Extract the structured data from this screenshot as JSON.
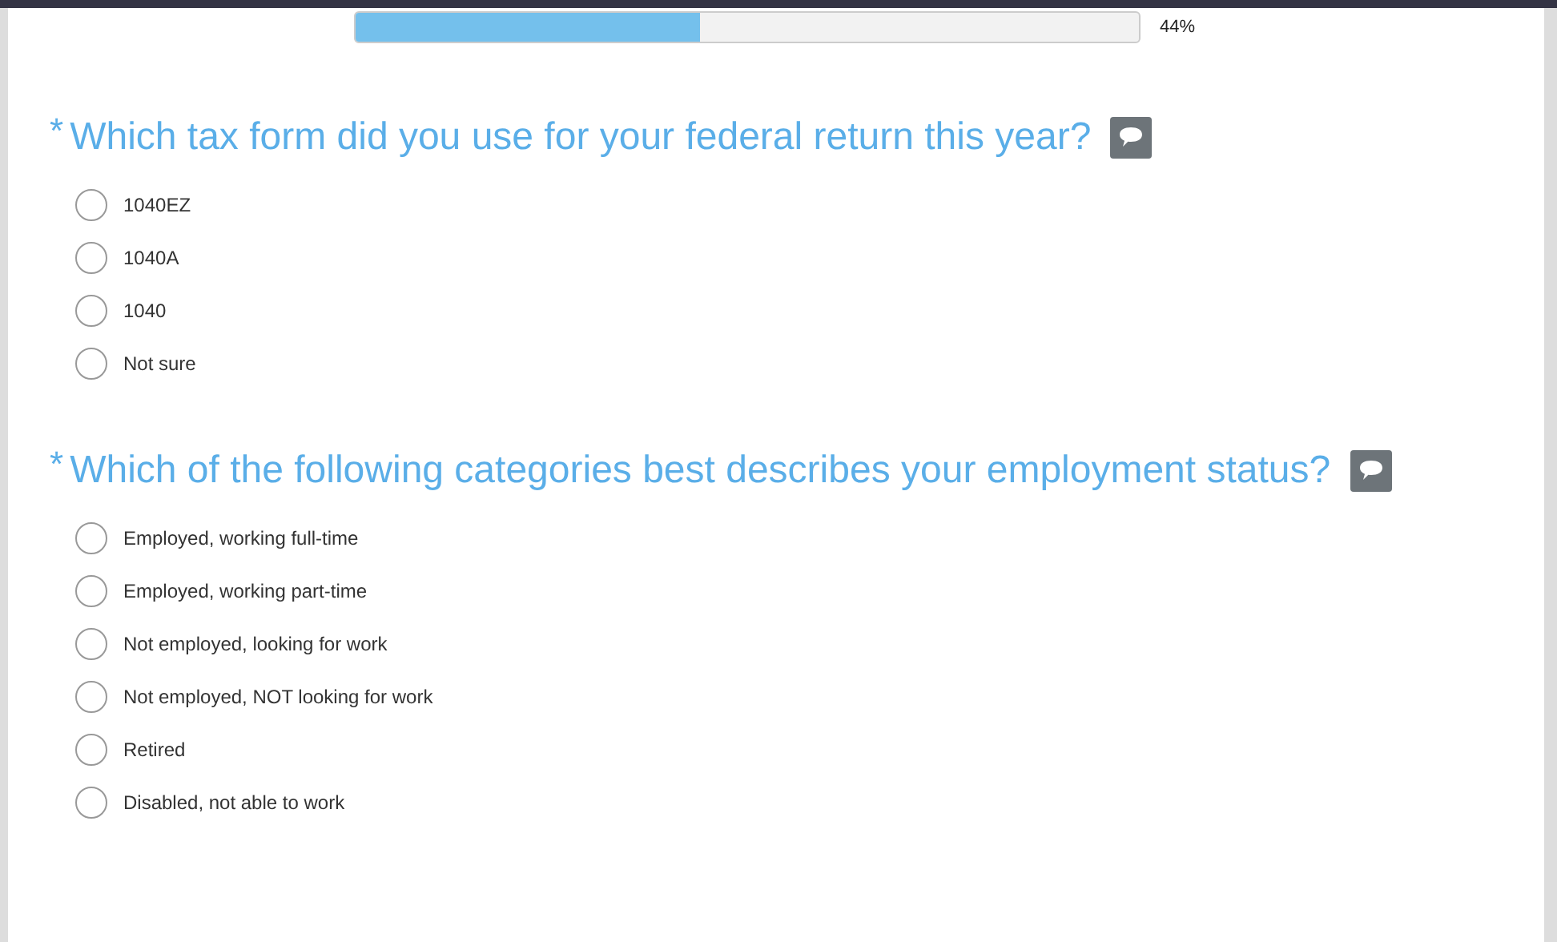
{
  "progress": {
    "level": 0.44,
    "reading": "44%"
  },
  "questions": [
    {
      "required": true,
      "asterisk": "*",
      "title": "Which tax form did you use for your federal return this year?",
      "options": [
        {
          "label": "1040EZ",
          "selected": false
        },
        {
          "label": "1040A",
          "selected": false
        },
        {
          "label": "1040",
          "selected": false
        },
        {
          "label": "Not sure",
          "selected": false
        }
      ]
    },
    {
      "required": true,
      "asterisk": "*",
      "title": "Which of the following categories best describes your employment status?",
      "options": [
        {
          "label": "Employed, working full-time",
          "selected": false
        },
        {
          "label": "Employed, working part-time",
          "selected": false
        },
        {
          "label": "Not employed, looking for work",
          "selected": false
        },
        {
          "label": "Not employed, NOT looking for work",
          "selected": false
        },
        {
          "label": "Retired",
          "selected": false
        },
        {
          "label": "Disabled, not able to work",
          "selected": false
        }
      ]
    }
  ]
}
